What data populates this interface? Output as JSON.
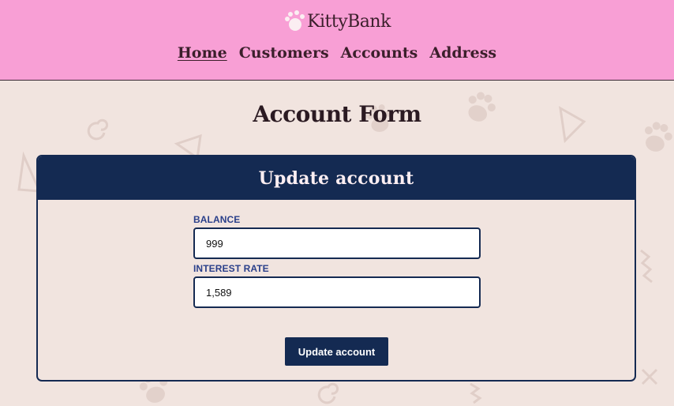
{
  "brand": {
    "name": "KittyBank",
    "logo_icon": "paw-icon"
  },
  "nav": [
    {
      "label": "Home",
      "active": true
    },
    {
      "label": "Customers",
      "active": false
    },
    {
      "label": "Accounts",
      "active": false
    },
    {
      "label": "Address",
      "active": false
    }
  ],
  "page_title": "Account Form",
  "form": {
    "heading": "Update account",
    "balance": {
      "label": "BALANCE",
      "value": "999"
    },
    "interest_rate": {
      "label": "INTEREST RATE",
      "value": "1,589"
    },
    "submit_label": "Update account"
  },
  "colors": {
    "header_bg": "#f89fd5",
    "page_bg": "#f1e4df",
    "navy": "#142a52",
    "label_blue": "#2a3f8a"
  }
}
